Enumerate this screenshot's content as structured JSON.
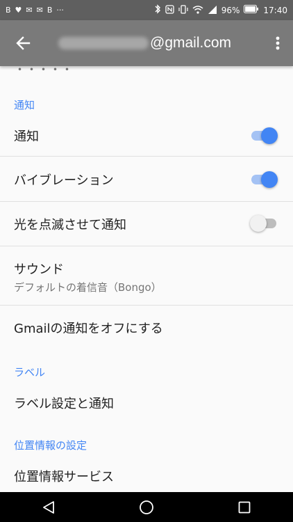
{
  "status_bar": {
    "left_icons": [
      "B",
      "♥",
      "✉",
      "✉",
      "B",
      "···"
    ],
    "battery": "96%",
    "time": "17:40"
  },
  "toolbar": {
    "title_suffix": "@gmail.com"
  },
  "sections": [
    {
      "header": "通知"
    },
    {
      "header": "ラベル"
    },
    {
      "header": "位置情報の設定"
    }
  ],
  "rows": {
    "notifications": {
      "label": "通知",
      "toggle": true
    },
    "vibration": {
      "label": "バイブレーション",
      "toggle": true
    },
    "light": {
      "label": "光を点滅させて通知",
      "toggle": false
    },
    "sound": {
      "label": "サウンド",
      "sub": "デフォルトの着信音（Bongo）"
    },
    "gmail_off": {
      "label": "Gmailの通知をオフにする"
    },
    "label_settings": {
      "label": "ラベル設定と通知"
    },
    "location": {
      "label": "位置情報サービス"
    }
  },
  "colors": {
    "accent": "#4285f4",
    "toolbar": "#7a7a7a",
    "statusbar": "#5f5f5f"
  }
}
